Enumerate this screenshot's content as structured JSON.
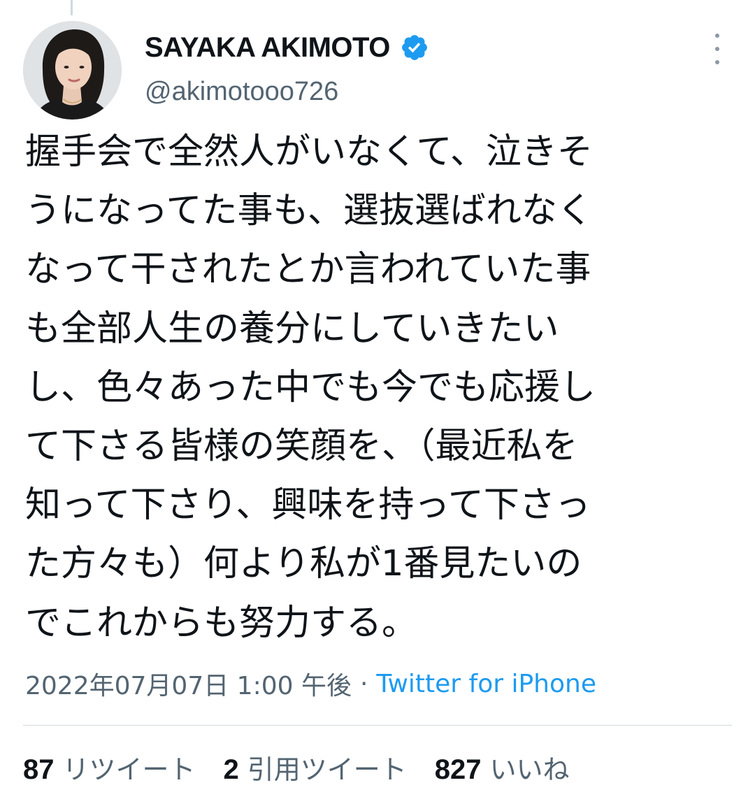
{
  "author": {
    "display_name": "SAYAKA AKIMOTO",
    "handle": "@akimotooo726",
    "verified": true
  },
  "tweet": {
    "lines": [
      "握手会で全然人がいなくて、泣きそ",
      "うになってた事も、選抜選ばれなく",
      "なって干されたとか言われていた事",
      "も全部人生の養分にしていきたい",
      "し、色々あった中でも今でも応援し",
      "て下さる皆様の笑顔を、（最近私を",
      "知って下さり、興味を持って下さっ",
      "た方々も）何より私が1番見たいの",
      "でこれからも努力する。"
    ]
  },
  "meta": {
    "timestamp": "2022年07月07日 1:00 午後",
    "separator": "·",
    "source": "Twitter for iPhone"
  },
  "stats": {
    "retweets": {
      "count": "87",
      "label": "リツイート"
    },
    "quotes": {
      "count": "2",
      "label": "引用ツイート"
    },
    "likes": {
      "count": "827",
      "label": "いいね"
    }
  },
  "colors": {
    "text": "#0f1419",
    "secondary": "#536471",
    "link": "#1d9bf0",
    "verified": "#1d9bf0",
    "divider": "#cfd9de"
  },
  "icons": {
    "verified": "verified-badge-icon",
    "more": "more-vertical-icon"
  }
}
